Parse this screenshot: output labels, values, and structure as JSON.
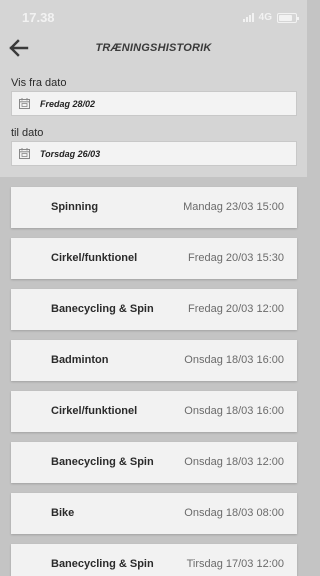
{
  "status_bar": {
    "time": "17.38",
    "network": "4G"
  },
  "header": {
    "title": "TRÆNINGSHISTORIK"
  },
  "filters": {
    "from_label": "Vis fra dato",
    "from_value": "Fredag 28/02",
    "to_label": "til dato",
    "to_value": "Torsdag 26/03"
  },
  "history": [
    {
      "activity": "Spinning",
      "datetime": "Mandag 23/03 15:00"
    },
    {
      "activity": "Cirkel/funktionel",
      "datetime": "Fredag 20/03 15:30"
    },
    {
      "activity": "Banecycling & Spin",
      "datetime": "Fredag 20/03 12:00"
    },
    {
      "activity": "Badminton",
      "datetime": "Onsdag 18/03 16:00"
    },
    {
      "activity": "Cirkel/funktionel",
      "datetime": "Onsdag 18/03 16:00"
    },
    {
      "activity": "Banecycling & Spin",
      "datetime": "Onsdag 18/03 12:00"
    },
    {
      "activity": "Bike",
      "datetime": "Onsdag 18/03 08:00"
    },
    {
      "activity": "Banecycling & Spin",
      "datetime": "Tirsdag 17/03 12:00"
    }
  ]
}
